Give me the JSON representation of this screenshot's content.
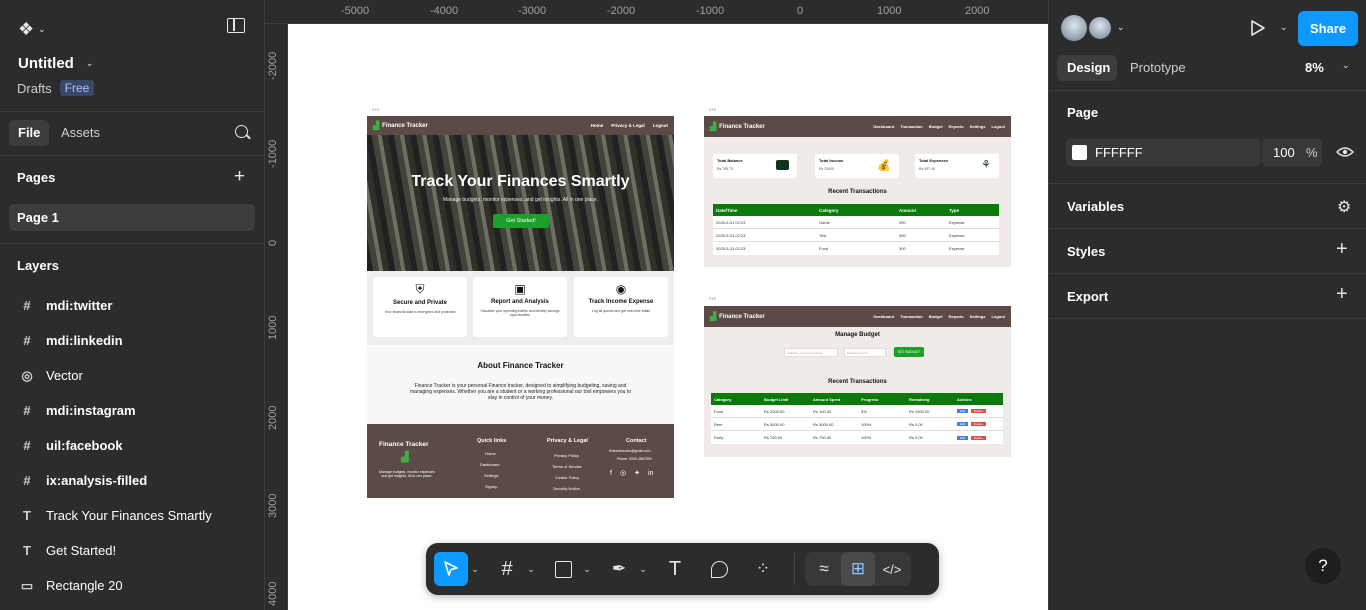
{
  "file": {
    "name": "Untitled",
    "location": "Drafts",
    "plan_badge": "Free"
  },
  "left_tabs": {
    "file": "File",
    "assets": "Assets"
  },
  "pages": {
    "title": "Pages",
    "items": [
      "Page 1"
    ]
  },
  "layers": {
    "title": "Layers",
    "items": [
      {
        "name": "mdi:twitter",
        "icon": "frame-icon"
      },
      {
        "name": "mdi:linkedin",
        "icon": "frame-icon"
      },
      {
        "name": "Vector",
        "icon": "vector-icon"
      },
      {
        "name": "mdi:instagram",
        "icon": "frame-icon"
      },
      {
        "name": "uil:facebook",
        "icon": "frame-icon"
      },
      {
        "name": "ix:analysis-filled",
        "icon": "frame-icon"
      },
      {
        "name": "Track Your Finances Smartly",
        "icon": "text-icon"
      },
      {
        "name": "Get Started!",
        "icon": "text-icon"
      },
      {
        "name": "Rectangle 20",
        "icon": "rectangle-icon"
      }
    ]
  },
  "ruler": {
    "top": [
      "-5000",
      "-4000",
      "-3000",
      "-2000",
      "-1000",
      "0",
      "1000",
      "2000"
    ],
    "left": [
      "-2000",
      "-1000",
      "0",
      "1000",
      "2000",
      "3000",
      "4000"
    ]
  },
  "right_panel": {
    "tabs": {
      "design": "Design",
      "prototype": "Prototype"
    },
    "zoom": "8%",
    "share": "Share",
    "page_section": "Page",
    "page_color": "FFFFFF",
    "page_opacity": "100",
    "percent_sign": "%",
    "variables": "Variables",
    "styles": "Styles",
    "export": "Export"
  },
  "canvas": {
    "landing": {
      "brand": "Finance Tracker",
      "nav": [
        "Home",
        "Privacy & Legal",
        "Logout"
      ],
      "hero_title": "Track Your Finances Smartly",
      "hero_sub": "Manage budgets, monitor expenses, and get insights. All in one place.",
      "hero_btn": "Get Started!",
      "features": [
        {
          "title": "Secure and Private",
          "desc": "Your financial data is encrypted and protected"
        },
        {
          "title": "Report and Analysis",
          "desc": "Visualize your spending habits and identify savings opportunities"
        },
        {
          "title": "Track Income Expense",
          "desc": "Log all quests and get real-time totals"
        }
      ],
      "about_title": "About Finance Tracker",
      "about_text": "Finance Tracker is your personal Finance tracker, designed to simplifying budgeting, saving and managing expenses. Whether you are a student or a working professional our tool empowers you to stay in control of your money.",
      "footer": {
        "brand": "Finance Tracker",
        "brand_desc": "Manage budgets, monitor expenses and get insights. All in one place.",
        "quick_links_title": "Quick links",
        "quick_links": [
          "Home",
          "Dashboard",
          "Settings",
          "Signup"
        ],
        "privacy_title": "Privacy & Legal",
        "privacy_links": [
          "Privacy Policy",
          "Terms of Service",
          "Cookie Policy",
          "Security Notice"
        ],
        "contact_title": "Contact",
        "contact_lines": [
          "financetracker@gmail.com",
          "Phone: 0000-4567890"
        ]
      }
    },
    "dashboard": {
      "brand": "Finance Tracker",
      "nav": [
        "Dashboard",
        "Transaction",
        "Budget",
        "Reports",
        "Settings",
        "Logout"
      ],
      "cards": [
        {
          "title": "Total Balance",
          "value": "Rs 705.73"
        },
        {
          "title": "Total Income",
          "value": "Rs 20000"
        },
        {
          "title": "Total Expenses",
          "value": "Rs 997.45"
        }
      ],
      "table_title": "Recent Transactions",
      "headers": [
        "Date/Time",
        "Category",
        "Amount",
        "Type"
      ],
      "rows": [
        [
          "2025-5-31 02:23",
          "Game",
          "300",
          "Expense"
        ],
        [
          "2025-5-31 02:23",
          "Test",
          "300",
          "Expense"
        ],
        [
          "2025-5-31 02:23",
          "Food",
          "300",
          "Expense"
        ]
      ]
    },
    "budget": {
      "brand": "Finance Tracker",
      "nav": [
        "Dashboard",
        "Transaction",
        "Budget",
        "Reports",
        "Settings",
        "Logout"
      ],
      "title": "Manage Budget",
      "inputs": [
        "Category (e.g Food, Rent)",
        "Budget Amount"
      ],
      "btn": "SET BUDGET",
      "table_title": "Recent Transactions",
      "headers": [
        "Category",
        "Budget Limit",
        "Amount Spent",
        "Progress",
        "Remaining",
        "Actions"
      ],
      "rows": [
        [
          "Food",
          "Rs 2000.00",
          "Rs 100.00",
          "5%",
          "Rs 1900.00"
        ],
        [
          "Rent",
          "Rs 3000.00",
          "Rs 3000.00",
          "100%",
          "Rs 0.00"
        ],
        [
          "Party",
          "Rs 700.00",
          "Rs 700.00",
          "100%",
          "Rs 0.00"
        ]
      ],
      "edit": "Edit",
      "delete": "Delete"
    }
  }
}
